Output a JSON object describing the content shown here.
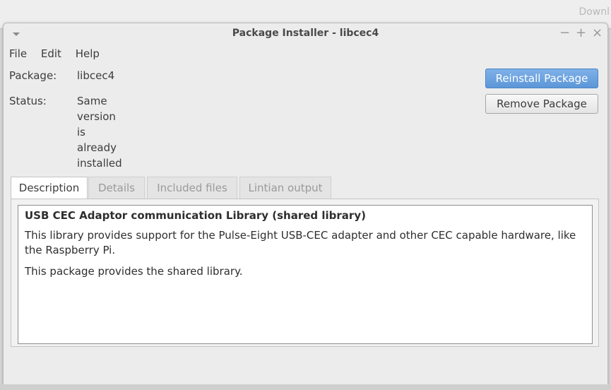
{
  "background_window": {
    "title": "Downl"
  },
  "window": {
    "title": "Package Installer - libcec4",
    "controls": {
      "minimize": "−",
      "maximize": "+",
      "close": "×"
    }
  },
  "menu": {
    "items": [
      "File",
      "Edit",
      "Help"
    ]
  },
  "package": {
    "label": "Package:",
    "value": "libcec4"
  },
  "status": {
    "label": "Status:",
    "value": "Same version is already installed"
  },
  "buttons": {
    "reinstall": "Reinstall Package",
    "remove": "Remove Package"
  },
  "tabs": [
    "Description",
    "Details",
    "Included files",
    "Lintian output"
  ],
  "description": {
    "title": "USB CEC Adaptor communication Library (shared library)",
    "paragraph1": "This library provides support for the Pulse-Eight USB-CEC adapter and other CEC capable hardware, like the Raspberry Pi.",
    "paragraph2": "This package provides the shared library."
  },
  "colors": {
    "accent": "#6aa3e0",
    "window_bg": "#ececec"
  }
}
